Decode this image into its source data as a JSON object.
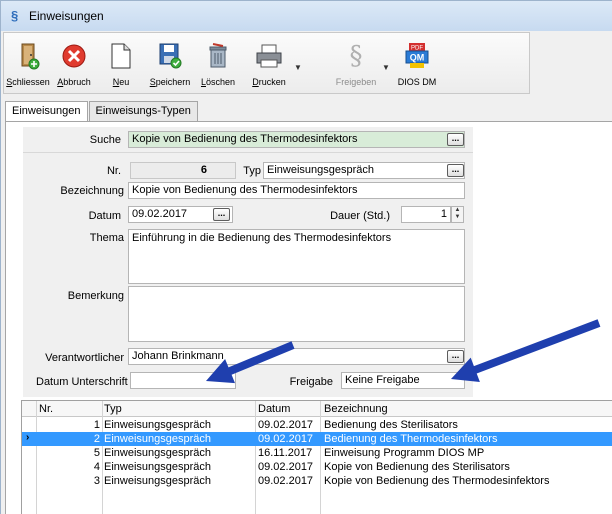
{
  "window": {
    "title": "Einweisungen"
  },
  "toolbar": {
    "buttons": [
      {
        "label": "Schliessen",
        "underline": "S",
        "rest": "chliessen",
        "icon": "close-door-icon"
      },
      {
        "label": "Abbruch",
        "underline": "A",
        "rest": "bbruch",
        "icon": "cancel-icon"
      },
      {
        "label": "Neu",
        "underline": "N",
        "rest": "eu",
        "icon": "new-document-icon"
      },
      {
        "label": "Speichern",
        "underline": "S",
        "rest": "peichern",
        "icon": "save-icon"
      },
      {
        "label": "Löschen",
        "underline": "L",
        "rest": "öschen",
        "icon": "delete-icon"
      },
      {
        "label": "Drucken",
        "underline": "D",
        "rest": "rucken",
        "icon": "printer-icon"
      },
      {
        "label": "Freigeben",
        "underline": "",
        "rest": "Freigeben",
        "icon": "paragraph-icon"
      },
      {
        "label": "DIOS DM",
        "underline": "",
        "rest": "DIOS DM",
        "icon": "pdf-qm-icon"
      }
    ]
  },
  "tabs": [
    {
      "label": "Einweisungen",
      "active": true
    },
    {
      "label": "Einweisungs-Typen",
      "active": false
    }
  ],
  "form": {
    "search_label": "Suche",
    "search_value": "Kopie von Bedienung des Thermodesinfektors",
    "nr_label": "Nr.",
    "nr_value": "6",
    "typ_label": "Typ",
    "typ_value": "Einweisungsgespräch",
    "bezeichnung_label": "Bezeichnung",
    "bezeichnung_value": "Kopie von Bedienung des Thermodesinfektors",
    "datum_label": "Datum",
    "datum_value": "09.02.2017",
    "dauer_label": "Dauer (Std.)",
    "dauer_value": "1",
    "thema_label": "Thema",
    "thema_value": "Einführung in die Bedienung des Thermodesinfektors",
    "bemerkung_label": "Bemerkung",
    "bemerkung_value": "",
    "verantwortlicher_label": "Verantwortlicher",
    "verantwortlicher_value": "Johann Brinkmann",
    "datum_unterschrift_label": "Datum Unterschrift",
    "datum_unterschrift_value": "",
    "freigabe_label": "Freigabe",
    "freigabe_value": "Keine Freigabe",
    "ellipsis": "..."
  },
  "grid": {
    "headers": [
      "Nr.",
      "Typ",
      "Datum",
      "Bezeichnung"
    ],
    "rows": [
      {
        "nr": "1",
        "typ": "Einweisungsgespräch",
        "datum": "09.02.2017",
        "bezeichnung": "Bedienung des Sterilisators",
        "selected": false
      },
      {
        "nr": "2",
        "typ": "Einweisungsgespräch",
        "datum": "09.02.2017",
        "bezeichnung": "Bedienung des Thermodesinfektors",
        "selected": true
      },
      {
        "nr": "5",
        "typ": "Einweisungsgespräch",
        "datum": "16.11.2017",
        "bezeichnung": "Einweisung Programm DIOS MP",
        "selected": false
      },
      {
        "nr": "4",
        "typ": "Einweisungsgespräch",
        "datum": "09.02.2017",
        "bezeichnung": "Kopie von Bedienung des Sterilisators",
        "selected": false
      },
      {
        "nr": "3",
        "typ": "Einweisungsgespräch",
        "datum": "09.02.2017",
        "bezeichnung": "Kopie von Bedienung des Thermodesinfektors",
        "selected": false
      }
    ],
    "current_row_marker": "›"
  },
  "colors": {
    "selection": "#3399ff",
    "search_field": "#d8ecd8",
    "annotation_arrow": "#1f3fae"
  }
}
